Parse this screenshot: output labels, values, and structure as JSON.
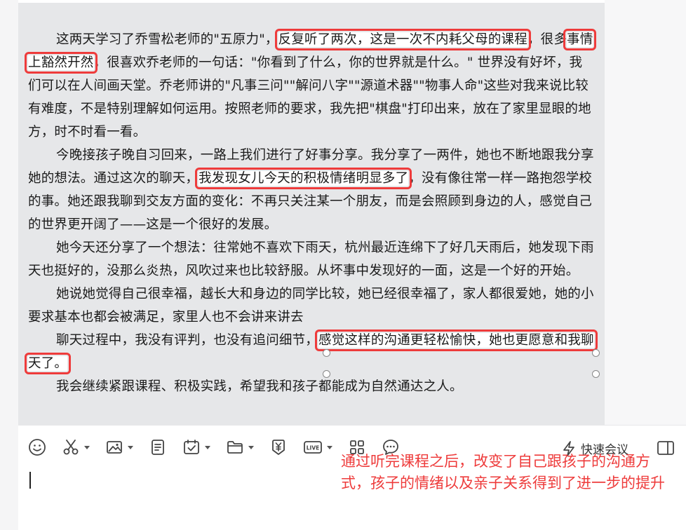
{
  "message": {
    "p1": {
      "t1": "这两天学习了乔雪松老师的\"五原力\"，",
      "hl1": "反复听了两次，这是一次不内耗父母的课程",
      "t2": "，很多",
      "hl2": "事情上豁然开然",
      "t3": "，很喜欢乔老师的一句话：\"你看到了什么，你的世界就是什么。\" 世界没有好坏，我们可以在人间画天堂。乔老师讲的\"凡事三问\"\"解问八字\"\"源道术器\"\"物事人命\"这些对我来说比较有难度，不是特别理解如何运用。按照老师的要求，我先把\"棋盘\"打印出来，放在了家里显眼的地方，时不时看一看。"
    },
    "p2": {
      "t1": "今晚接孩子晚自习回来，一路上我们进行了好事分享。我分享了一两件，她也不断地跟我分享她的想法。通过这次的聊天，",
      "hl1": "我发现女儿今天的积极情绪明显多了",
      "t2": "，没有像往常一样一路抱怨学校的事。她还跟我聊到交友方面的变化：不再只关注某一个朋友，而是会照顾到身边的人，感觉自己的世界更开阔了——这是一个很好的发展。"
    },
    "p3": "她今天还分享了一个想法：往常她不喜欢下雨天，杭州最近连绵下了好几天雨后，她发现下雨天也挺好的，没那么炎热，风吹过来也比较舒服。从坏事中发现好的一面，这是一个好的开始。",
    "p4": "她说她觉得自己很幸福，越长大和身边的同学比较，她已经很幸福了，家人都很爱她，她的小要求基本也都会被满足，家里人也不会讲来讲去",
    "p5": {
      "t1": "聊天过程中，我没有评判，也没有追问细节，",
      "hl1": "感觉这样的沟通更轻松愉快，她也更愿意和我聊天了。"
    },
    "p6": "我会继续紧跟课程、积极实践，希望我和孩子都能成为自然通达之人。"
  },
  "composer": {
    "quick_meeting_label": "快速会议",
    "annotation": "通过听完课程之后，改变了自己跟孩子的沟通方式，孩子的情绪以及亲子关系得到了进一步的提升"
  },
  "icons": [
    "emoji-icon",
    "scissors-icon",
    "image-icon",
    "document-icon",
    "calendar-check-icon",
    "folder-icon",
    "yen-icon",
    "live-icon",
    "apps-grid-icon",
    "chat-bubble-icon",
    "lightning-icon",
    "panel-toggle-icon"
  ],
  "colors": {
    "highlight_red": "#ee3b3b",
    "card_bg": "#e6e7e9"
  }
}
